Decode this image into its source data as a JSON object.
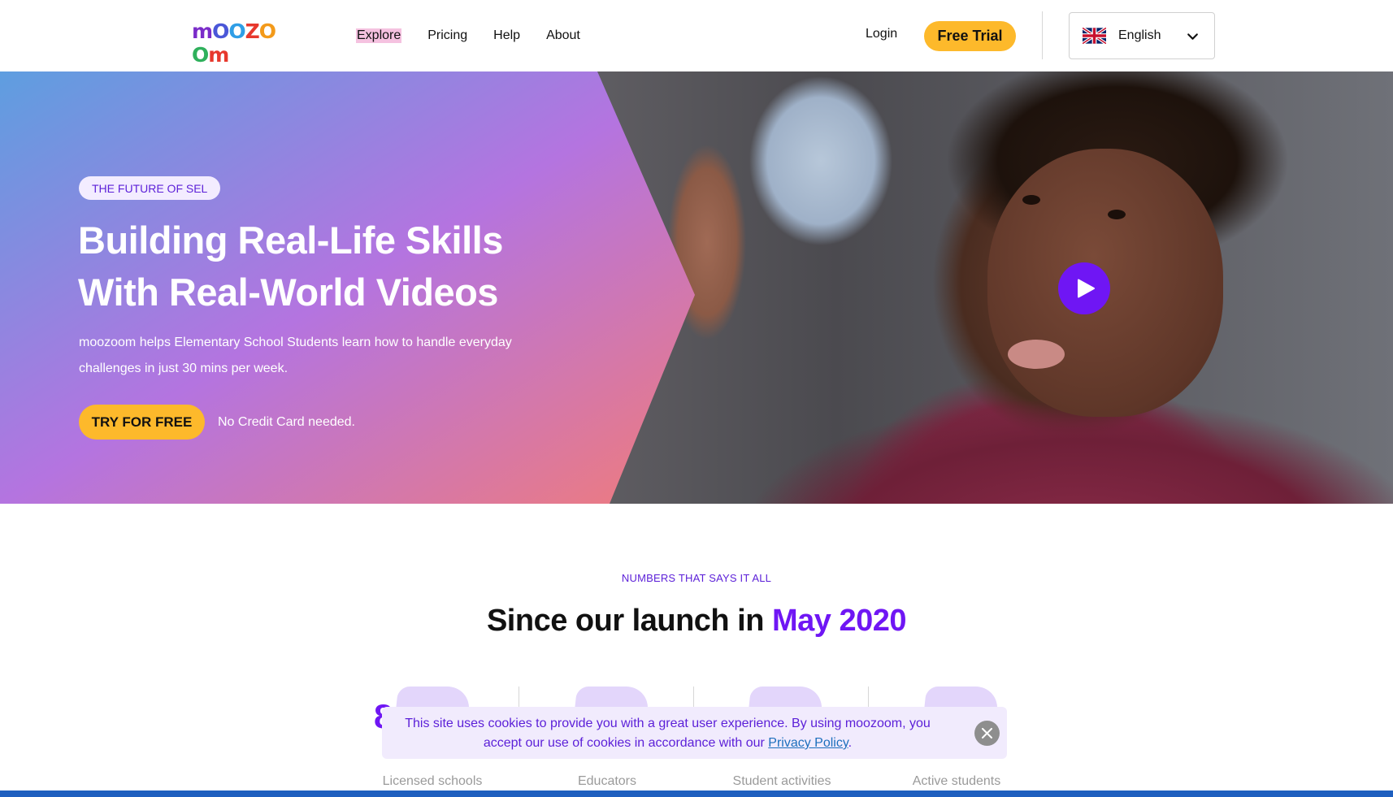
{
  "header": {
    "logo_text": "mOOZOOm",
    "nav": [
      {
        "label": "Explore",
        "active": true
      },
      {
        "label": "Pricing"
      },
      {
        "label": "Help"
      },
      {
        "label": "About"
      }
    ],
    "login_label": "Login",
    "trial_label": "Free Trial",
    "language": {
      "label": "English",
      "flag_icon": "uk-flag-icon"
    }
  },
  "hero": {
    "eyebrow": "THE FUTURE OF SEL",
    "title_line1": "Building Real-Life Skills",
    "title_line2": "With Real-World Videos",
    "subtitle_line1": "moozoom helps Elementary School Students learn how to handle everyday",
    "subtitle_line2": "challenges in just 30 mins per week.",
    "cta_label": "TRY FOR FREE",
    "cta_note": "No Credit Card needed.",
    "play_icon": "play-icon"
  },
  "numbers": {
    "eyebrow": "NUMBERS THAT SAYS IT ALL",
    "title_prefix": "Since our launch in ",
    "title_accent": "May 2020",
    "stats": [
      {
        "label": "Licensed schools"
      },
      {
        "label": "Educators"
      },
      {
        "label": "Student activities"
      },
      {
        "label": "Active students"
      }
    ]
  },
  "cookie": {
    "text_before": "This site uses cookies to provide you with a great user experience. By using moozoom, you accept our use of cookies in accordance with our ",
    "link_label": "Privacy Policy",
    "text_after": ".",
    "close_icon": "close-icon"
  },
  "colors": {
    "accent": "#6f16f4",
    "cta": "#fdb92b",
    "cookie_bg": "#f1ebfd"
  }
}
